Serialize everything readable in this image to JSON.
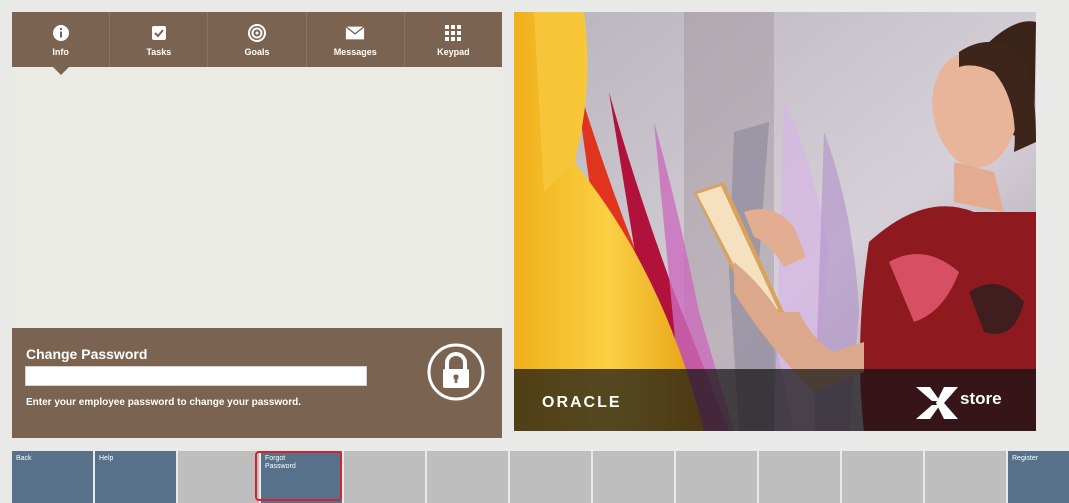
{
  "tabs": [
    {
      "label": "Info",
      "icon": "info-icon"
    },
    {
      "label": "Tasks",
      "icon": "checkbox-icon"
    },
    {
      "label": "Goals",
      "icon": "target-icon"
    },
    {
      "label": "Messages",
      "icon": "envelope-icon"
    },
    {
      "label": "Keypad",
      "icon": "keypad-grid-icon"
    }
  ],
  "active_tab": "Info",
  "change_password": {
    "title": "Change Password",
    "value": "",
    "hint": "Enter your employee password to change your password.",
    "icon": "lock-icon"
  },
  "promo": {
    "brand": "ORACLE",
    "product": "store",
    "image": "photo of woman using tablet in boutique with dresses"
  },
  "function_keys": [
    {
      "label": "Back",
      "enabled": true
    },
    {
      "label": "Help",
      "enabled": true
    },
    {
      "label": "",
      "enabled": false
    },
    {
      "label": "Forgot Password",
      "enabled": true
    },
    {
      "label": "",
      "enabled": false
    },
    {
      "label": "",
      "enabled": false
    },
    {
      "label": "",
      "enabled": false
    },
    {
      "label": "",
      "enabled": false
    },
    {
      "label": "",
      "enabled": false
    },
    {
      "label": "",
      "enabled": false
    },
    {
      "label": "",
      "enabled": false
    },
    {
      "label": "",
      "enabled": false
    },
    {
      "label": "Register",
      "enabled": true
    }
  ],
  "colors": {
    "panel_brown": "#7a6350",
    "fkey_blue": "#58718a",
    "fkey_gray": "#bebebe",
    "highlight_red": "#d8222b"
  }
}
